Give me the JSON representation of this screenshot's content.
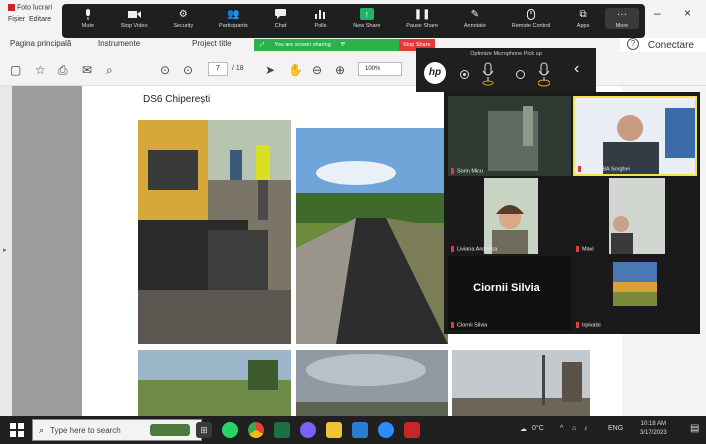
{
  "window": {
    "title": "Foto lucrari",
    "menu": [
      "Fișier",
      "Editare"
    ],
    "connect_label": "Conectare"
  },
  "zoom_toolbar": {
    "items": [
      {
        "label": "Mute",
        "icon": "microphone-icon"
      },
      {
        "label": "Stop Video",
        "icon": "video-camera-icon"
      },
      {
        "label": "Security",
        "icon": "shield-icon"
      },
      {
        "label": "Participants",
        "icon": "participants-icon",
        "count": "11"
      },
      {
        "label": "Chat",
        "icon": "chat-icon"
      },
      {
        "label": "Polls",
        "icon": "polls-icon"
      },
      {
        "label": "New Share",
        "icon": "share-screen-icon"
      },
      {
        "label": "Pause Share",
        "icon": "pause-icon"
      },
      {
        "label": "Annotate",
        "icon": "pen-icon"
      },
      {
        "label": "Remote Control",
        "icon": "mouse-icon"
      },
      {
        "label": "Apps",
        "icon": "apps-icon"
      },
      {
        "label": "More",
        "icon": "more-icon"
      }
    ]
  },
  "tabs": {
    "home": "Pagina principală",
    "tools": "Instrumente",
    "doc": "Project title"
  },
  "share_banner": {
    "status": "You are screen sharing",
    "stop": "Stop Share"
  },
  "pdf_toolbar": {
    "current_page": "7",
    "total_pages": "/ 18",
    "zoom": "100%"
  },
  "document": {
    "heading": "DS6 Chiperești"
  },
  "mic_popup": {
    "caption": "Optimize Microphone Pick up"
  },
  "gallery": {
    "participants": [
      {
        "name": "Sorin Micu"
      },
      {
        "name": "CULBABA Sorghei",
        "active": true
      },
      {
        "name": "Liviana Andreica"
      },
      {
        "name": "Mavi"
      },
      {
        "name": "Ciornii Silvia",
        "camera_off": true
      },
      {
        "name": "Irpivalsi"
      }
    ],
    "big_name": "Ciornii Silvia"
  },
  "taskbar": {
    "search_placeholder": "Type here to search",
    "weather": "0°C",
    "language": "ENG",
    "time": "10:18 AM",
    "date": "3/17/2023"
  },
  "colors": {
    "share_green": "#2bb34b",
    "stop_red": "#e53935",
    "active_speaker": "#f2e24b",
    "zoom_toolbar_bg": "#1f1f1f"
  }
}
